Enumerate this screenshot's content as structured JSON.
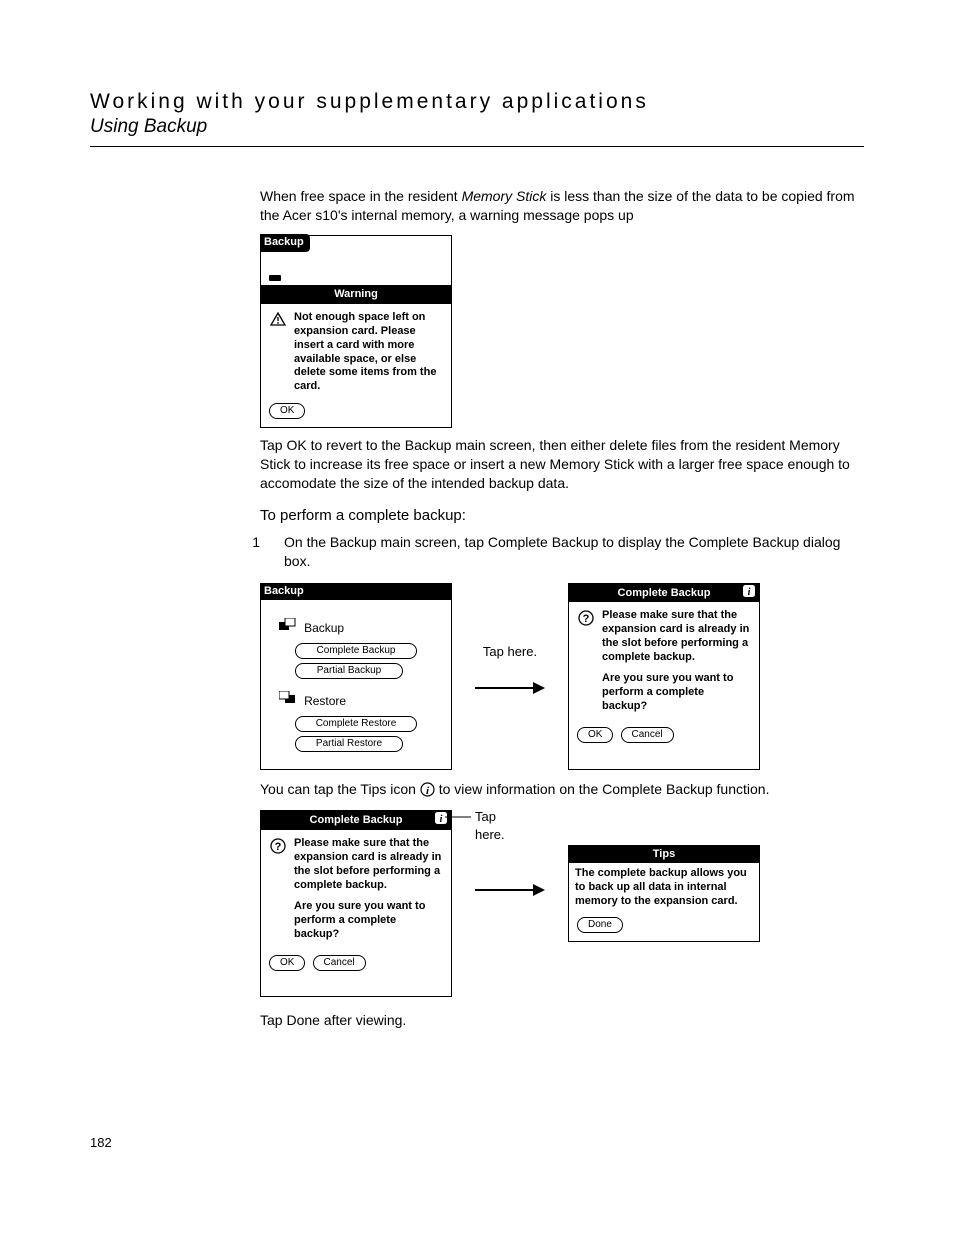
{
  "header": {
    "title": "Working with your supplementary applications",
    "subtitle": "Using Backup"
  },
  "para1_a": "When free space in the resident ",
  "para1_mem": "Memory Stick",
  "para1_b": " is less than the size of the data to be copied from the Acer s10's internal memory, a warning message pops up",
  "warning_shot": {
    "tab": "Backup",
    "header": "Warning",
    "message": "Not enough space left on expansion card. Please insert a card with more available space, or else delete some items from the card.",
    "ok": "OK"
  },
  "para2": "Tap OK to revert to the Backup main screen, then either delete files from the resident Memory Stick to increase its free space or insert a new Memory Stick with a larger free space enough to accomodate the size of the intended backup data.",
  "heading1": "To perform a complete backup:",
  "step1_num": "1",
  "step1_text": "On the Backup main screen, tap Complete Backup to display the Complete Backup dialog box.",
  "backup_main": {
    "tab": "Backup",
    "section_backup": "Backup",
    "btn_complete_backup": "Complete Backup",
    "btn_partial_backup": "Partial Backup",
    "section_restore": "Restore",
    "btn_complete_restore": "Complete Restore",
    "btn_partial_restore": "Partial Restore"
  },
  "tap_here": "Tap here.",
  "complete_backup_dialog": {
    "header": "Complete Backup",
    "msg1": "Please make sure that the expansion card is already in the slot before performing a complete backup.",
    "msg2": "Are you sure you want to perform a complete backup?",
    "ok": "OK",
    "cancel": "Cancel"
  },
  "para3_a": "You can tap the Tips icon ",
  "para3_b": " to view information on the Complete Backup function.",
  "tips_box": {
    "header": "Tips",
    "body": "The complete backup allows you to back up all data in internal memory to the expansion card.",
    "done": "Done"
  },
  "para4": "Tap Done after viewing.",
  "page_number": "182"
}
